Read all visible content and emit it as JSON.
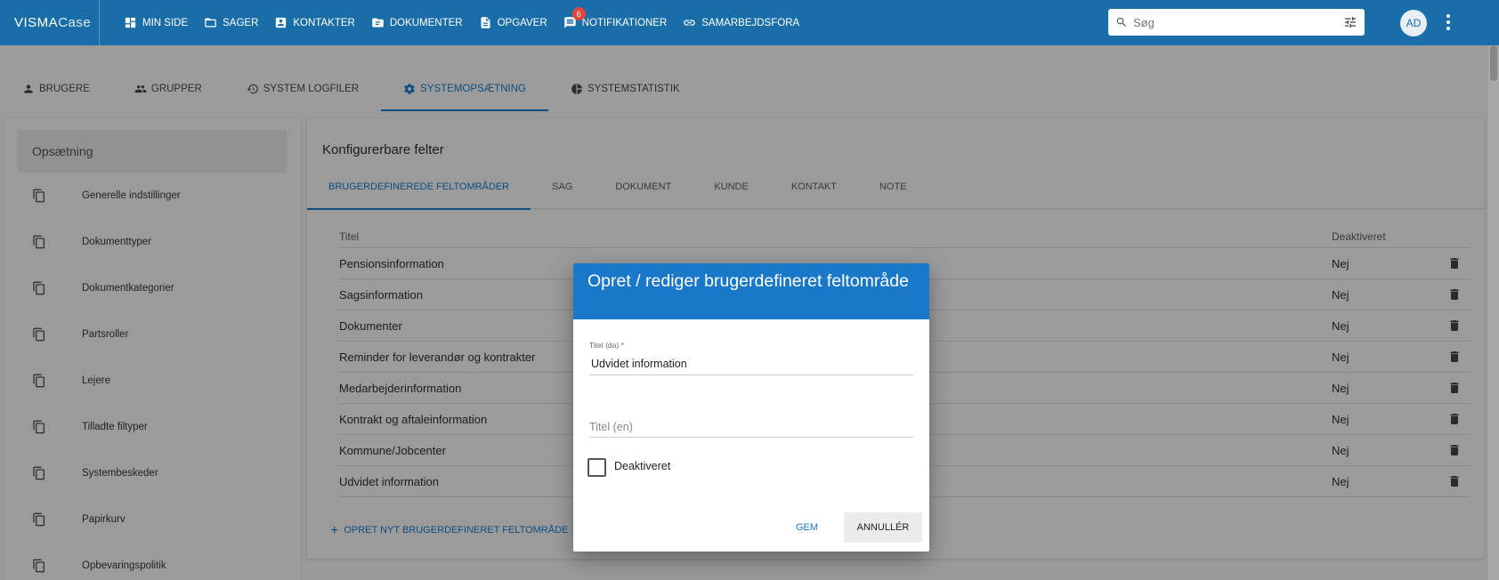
{
  "brand": {
    "part1": "VISMA",
    "part2": "Case"
  },
  "topnav": [
    {
      "label": "MIN SIDE",
      "icon": "dashboard-icon"
    },
    {
      "label": "SAGER",
      "icon": "folder-icon"
    },
    {
      "label": "KONTAKTER",
      "icon": "contact-card-icon"
    },
    {
      "label": "DOKUMENTER",
      "icon": "document-folder-icon"
    },
    {
      "label": "OPGAVER",
      "icon": "task-icon"
    },
    {
      "label": "NOTIFIKATIONER",
      "icon": "notification-icon",
      "badge": "6"
    },
    {
      "label": "SAMARBEJDSFORA",
      "icon": "link-icon"
    }
  ],
  "search": {
    "placeholder": "Søg"
  },
  "user": {
    "initials": "AD"
  },
  "subtabs": [
    {
      "label": "BRUGERE",
      "icon": "person-icon"
    },
    {
      "label": "GRUPPER",
      "icon": "people-icon"
    },
    {
      "label": "SYSTEM LOGFILER",
      "icon": "history-icon"
    },
    {
      "label": "SYSTEMOPSÆTNING",
      "icon": "gear-icon",
      "active": true
    },
    {
      "label": "SYSTEMSTATISTIK",
      "icon": "pie-chart-icon"
    }
  ],
  "sidebar": {
    "title": "Opsætning",
    "items": [
      "Generelle indstillinger",
      "Dokumenttyper",
      "Dokumentkategorier",
      "Partsroller",
      "Lejere",
      "Tilladte filtyper",
      "Systembeskeder",
      "Papirkurv",
      "Opbevaringspolitik"
    ]
  },
  "main": {
    "title": "Konfigurerbare felter",
    "tabs": [
      {
        "label": "BRUGERDEFINEREDE FELTOMRÅDER",
        "active": true
      },
      {
        "label": "SAG"
      },
      {
        "label": "DOKUMENT"
      },
      {
        "label": "KUNDE"
      },
      {
        "label": "KONTAKT"
      },
      {
        "label": "NOTE"
      }
    ],
    "columns": [
      "Titel",
      "Deaktiveret"
    ],
    "rows": [
      {
        "title": "Pensionsinformation",
        "disabled": "Nej"
      },
      {
        "title": "Sagsinformation",
        "disabled": "Nej"
      },
      {
        "title": "Dokumenter",
        "disabled": "Nej"
      },
      {
        "title": "Reminder for leverandør og kontrakter",
        "disabled": "Nej"
      },
      {
        "title": "Medarbejderinformation",
        "disabled": "Nej"
      },
      {
        "title": "Kontrakt og aftaleinformation",
        "disabled": "Nej"
      },
      {
        "title": "Kommune/Jobcenter",
        "disabled": "Nej"
      },
      {
        "title": "Udvidet information",
        "disabled": "Nej"
      }
    ],
    "add_label": "OPRET NYT BRUGERDEFINERET FELTOMRÅDE"
  },
  "dialog": {
    "title": "Opret / rediger brugerdefineret feltområde",
    "field1_label": "Titel (da) *",
    "field1_value": "Udvidet information",
    "field2_placeholder": "Titel (en)",
    "field2_value": "",
    "checkbox_label": "Deaktiveret",
    "checkbox_checked": false,
    "save_label": "GEM",
    "cancel_label": "ANNULLÉR"
  },
  "colors": {
    "primary": "#1a6ea8",
    "dialog_header": "#1a78c9",
    "badge": "#e0473c"
  }
}
